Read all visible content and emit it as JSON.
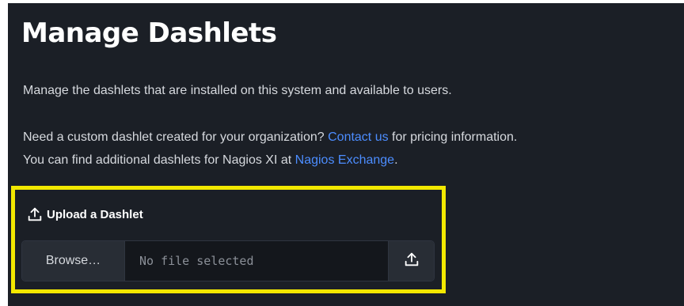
{
  "page": {
    "title": "Manage Dashlets",
    "intro": "Manage the dashlets that are installed on this system and available to users.",
    "custom_prefix": "Need a custom dashlet created for your organization? ",
    "contact_link": "Contact us",
    "custom_suffix": " for pricing information.",
    "exchange_prefix": "You can find additional dashlets for Nagios XI at ",
    "exchange_link": "Nagios Exchange",
    "exchange_suffix": "."
  },
  "upload": {
    "heading": "Upload a Dashlet",
    "browse_label": "Browse…",
    "file_status": "No file selected",
    "heading_icon": "upload-icon",
    "button_icon": "upload-icon"
  },
  "colors": {
    "background": "#1b1f26",
    "link": "#4c8dff",
    "highlight": "#f3e800"
  }
}
